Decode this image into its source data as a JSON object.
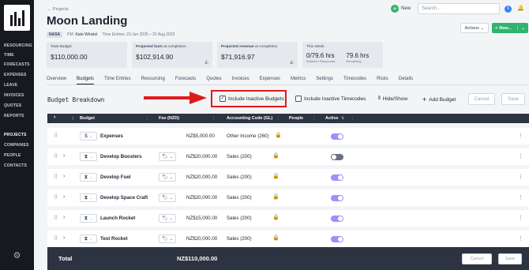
{
  "sidebar": {
    "nav": [
      {
        "label": "RESOURCING",
        "active": false
      },
      {
        "label": "TIME",
        "active": false
      },
      {
        "label": "FORECASTS",
        "active": false
      },
      {
        "label": "EXPENSES",
        "active": false
      },
      {
        "label": "LEAVE",
        "active": false
      },
      {
        "label": "INVOICES",
        "active": false
      },
      {
        "label": "QUOTES",
        "active": false
      },
      {
        "label": "REPORTS",
        "active": false
      },
      {
        "label": "PROJECTS",
        "active": true
      },
      {
        "label": "COMPANIES",
        "active": false
      },
      {
        "label": "PEOPLE",
        "active": false
      },
      {
        "label": "CONTACTS",
        "active": false
      }
    ],
    "settings_icon": "gear-icon"
  },
  "header": {
    "breadcrumb": "← Projects",
    "title": "Moon Landing",
    "client_tag": "NASA",
    "pm_label": "PM:",
    "pm_name": "Kate Winslet",
    "time_entries": "Time Entries: 23 Jun 2025 – 22 Aug 2025",
    "new_link": "New",
    "search_placeholder": "Search...",
    "actions_label": "Actions",
    "new_button": "New..."
  },
  "cards": {
    "total_budget": {
      "label": "Total Budget",
      "value": "$110,000.00"
    },
    "burn": {
      "label_bold": "Projected burn",
      "label_rest": " at completion",
      "value": "$102,914.90"
    },
    "revenue": {
      "label_bold": "Projected revenue",
      "label_rest": " at completion",
      "value": "$71,916.97"
    },
    "this_week": {
      "label": "This Week",
      "hours": "0/79.6 hrs",
      "hours_sub": "Worked / Resourced",
      "remaining": "79.6 hrs",
      "remaining_sub": "Remaining"
    }
  },
  "tabs": [
    "Overview",
    "Budgets",
    "Time Entries",
    "Resourcing",
    "Forecasts",
    "Quotes",
    "Invoices",
    "Expenses",
    "Metrics",
    "Settings",
    "Timecodes",
    "Risks",
    "Details"
  ],
  "active_tab": "Budgets",
  "toolbar": {
    "section_title": "Budget Breakdown",
    "include_inactive_budgets": "Include Inactive Budgets",
    "include_inactive_budgets_checked": true,
    "include_inactive_timecodes": "Include Inactive Timecodes",
    "include_inactive_timecodes_checked": false,
    "hide_show": "Hide/Show",
    "add_budget": "Add Budget",
    "cancel": "Cancel",
    "save": "Save"
  },
  "table": {
    "headers": {
      "budget": "Budget",
      "fee": "Fee (NZD)",
      "accounting_code": "Accounting Code (GL)",
      "people": "People",
      "active": "Active"
    },
    "rows": [
      {
        "type": "$",
        "name": "Expenses",
        "fee": "NZ$5,000.00",
        "code": "Other Income (260)",
        "active": true,
        "expandable": false,
        "tag": false
      },
      {
        "type": "⧗",
        "name": "Develop Boosters",
        "fee": "NZ$20,000.00",
        "code": "Sales (200)",
        "active": false,
        "expandable": true,
        "tag": true
      },
      {
        "type": "⧗",
        "name": "Develop Fuel",
        "fee": "NZ$20,000.00",
        "code": "Sales (200)",
        "active": true,
        "expandable": true,
        "tag": true
      },
      {
        "type": "⧗",
        "name": "Develop Space Craft",
        "fee": "NZ$20,000.00",
        "code": "Sales (200)",
        "active": true,
        "expandable": true,
        "tag": true
      },
      {
        "type": "⧗",
        "name": "Launch Rocket",
        "fee": "NZ$15,000.00",
        "code": "Sales (200)",
        "active": true,
        "expandable": true,
        "tag": true
      },
      {
        "type": "⧗",
        "name": "Test Rocket",
        "fee": "NZ$20,000.00",
        "code": "Sales (200)",
        "active": true,
        "expandable": true,
        "tag": true
      }
    ],
    "footer": {
      "label": "Total",
      "value": "NZ$110,000.00",
      "cancel": "Cancel",
      "save": "Save"
    }
  },
  "colors": {
    "accent": "#2fb36d",
    "toggle_on": "#a78bfa",
    "highlight": "#e01b1b",
    "dark": "#2b3440"
  }
}
